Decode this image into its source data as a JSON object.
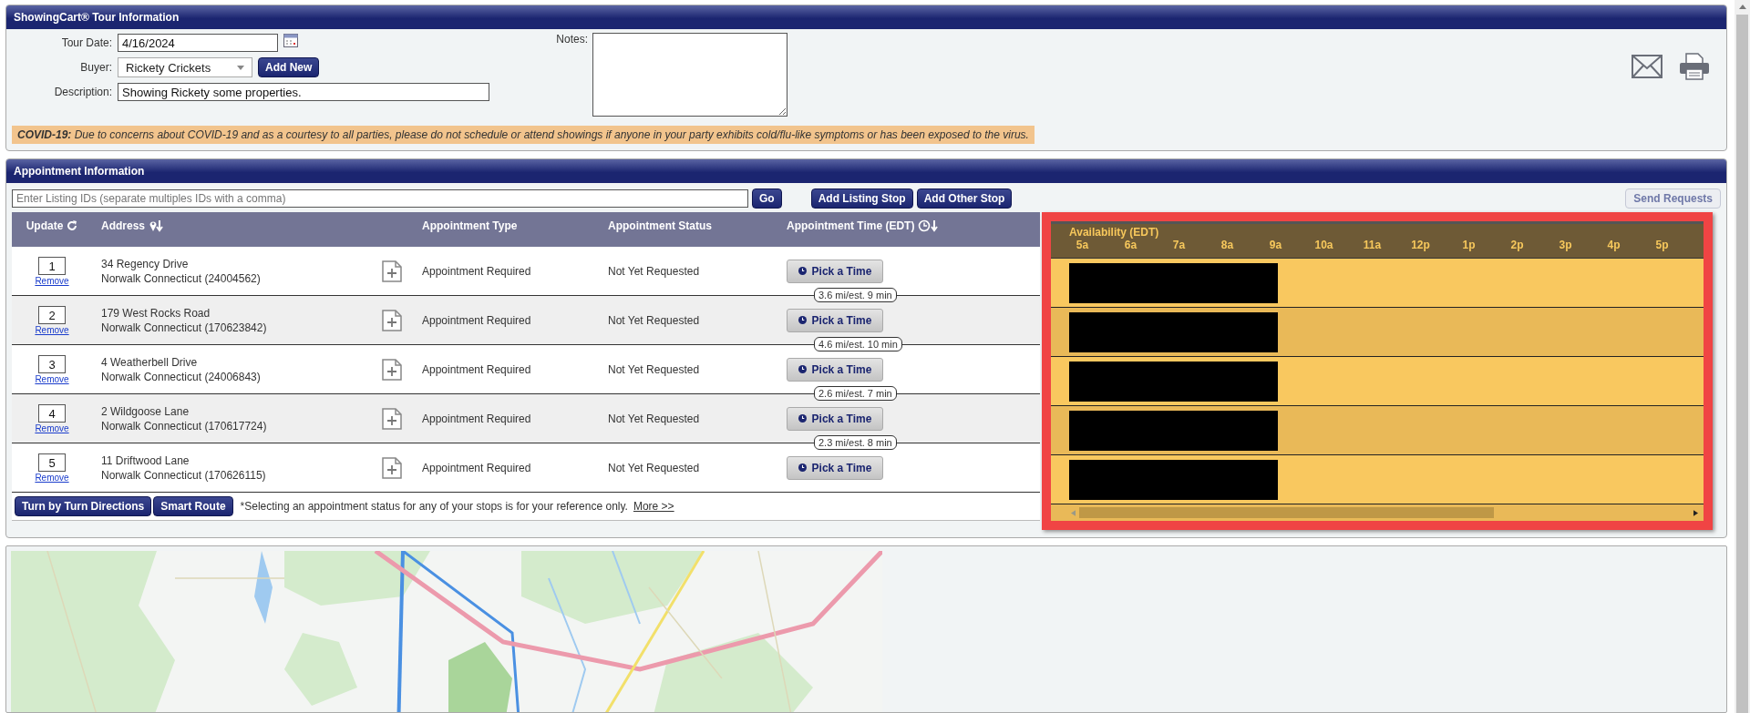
{
  "tour_panel": {
    "title": "ShowingCart® Tour Information",
    "tour_date": {
      "label": "Tour Date:",
      "value": "4/16/2024"
    },
    "buyer": {
      "label": "Buyer:",
      "value": "Rickety Crickets"
    },
    "add_new_button": "Add New",
    "description": {
      "label": "Description:",
      "value": "Showing Rickety some properties."
    },
    "notes": {
      "label": "Notes:"
    },
    "covid_notice": "**COVID-19:** Due to concerns about COVID-19 and as a courtesy to all parties, please do not schedule or attend showings if anyone in your party exhibits cold/flu-like symptoms or has been exposed to the virus."
  },
  "appointment_panel": {
    "title": "Appointment Information",
    "listing_ids": {
      "placeholder": "Enter Listing IDs (separate multiples IDs with a comma)"
    },
    "go_button": "Go",
    "stop_buttons": [
      "Add Listing Stop",
      "Add Other Stop"
    ],
    "send_requests": {
      "label": "Send Requests",
      "disabled": true
    },
    "columns": [
      "Update",
      "Address",
      "Appointment Type",
      "Appointment Status",
      "Appointment Time (EDT)"
    ],
    "stops": [
      {
        "order": "1",
        "remove": "Remove",
        "street": "34 Regency Drive",
        "city": "Norwalk Connecticut (24004562)",
        "type": "Appointment Required",
        "status": "Not Yet Requested",
        "time_button": "Pick a Time",
        "leg": "3.6 mi/est. 9 min"
      },
      {
        "order": "2",
        "remove": "Remove",
        "street": "179 West Rocks Road",
        "city": "Norwalk Connecticut (170623842)",
        "type": "Appointment Required",
        "status": "Not Yet Requested",
        "time_button": "Pick a Time",
        "leg": "4.6 mi/est. 10 min"
      },
      {
        "order": "3",
        "remove": "Remove",
        "street": "4 Weatherbell Drive",
        "city": "Norwalk Connecticut (24006843)",
        "type": "Appointment Required",
        "status": "Not Yet Requested",
        "time_button": "Pick a Time",
        "leg": "2.6 mi/est. 7 min"
      },
      {
        "order": "4",
        "remove": "Remove",
        "street": "2 Wildgoose Lane",
        "city": "Norwalk Connecticut (170617724)",
        "type": "Appointment Required",
        "status": "Not Yet Requested",
        "time_button": "Pick a Time",
        "leg": "2.3 mi/est. 8 min"
      },
      {
        "order": "5",
        "remove": "Remove",
        "street": "11 Driftwood Lane",
        "city": "Norwalk Connecticut (170626115)",
        "type": "Appointment Required",
        "status": "Not Yet Requested",
        "time_button": "Pick a Time"
      }
    ],
    "footer_buttons": [
      "Turn by Turn Directions",
      "Smart Route"
    ],
    "footnote": "*Selecting an appointment status for any of your stops is for your reference only.",
    "more_link": "More >>",
    "availability": {
      "title": "Availability (EDT)",
      "hours": [
        "5a",
        "6a",
        "7a",
        "8a",
        "9a",
        "10a",
        "11a",
        "12p",
        "1p",
        "2p",
        "3p",
        "4p",
        "5p"
      ]
    }
  }
}
